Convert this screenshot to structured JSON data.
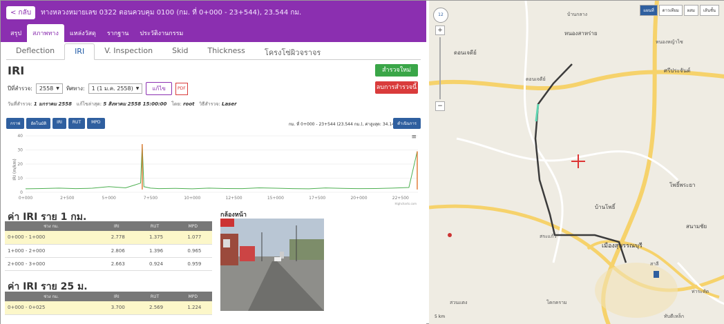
{
  "header": {
    "back_label": "< กลับ",
    "title": "ทางหลวงหมายเลข 0322 ตอนควบคุม 0100 (กม. ที่ 0+000 - 23+544), 23.544 กม."
  },
  "main_tabs": [
    "สรุป",
    "สภาพทาง",
    "แหล่งวัสดุ",
    "รากฐาน",
    "ประวัติงานกรรม"
  ],
  "sub_tabs": [
    "Deflection",
    "IRI",
    "V. Inspection",
    "Skid",
    "Thickness",
    "โครงโซ่ผิวจราจร"
  ],
  "section_heading": "IRI",
  "buttons": {
    "new_survey": "สำรวจใหม่",
    "delete_survey": "ลบการสำรวจนี้",
    "edit": "แก้ไข",
    "pdf": "PDF"
  },
  "filters": {
    "year_label": "ปีที่สำรวจ:",
    "year_value": "2558",
    "dir_label": "ทิศทาง:",
    "dir_value": "1 (1 ม.ค. 2558)"
  },
  "meta": {
    "survey_label": "วันที่สำรวจ:",
    "survey_date": "1 มกราคม 2558",
    "updated_label": "แก้ไขล่าสุด:",
    "updated_date": "5 สิงหาคม 2558 15:00:00",
    "by_label": "โดย:",
    "by_value": "root",
    "method_label": "วิธีสำรวจ:",
    "method_value": "Laser"
  },
  "graph_toolbar": [
    "กราฟ",
    "อัตโนมัติ",
    "IRI",
    "RUT",
    "MPD"
  ],
  "range_info": "กม. ที่ 0+000 - 23+544 (23.544 กม.), ค่าสูงสุด: 34.14",
  "range_button": "ดำเนินการ",
  "chart_data": {
    "type": "line",
    "ylabel": "IRI (m/km)",
    "ylim": [
      0,
      40
    ],
    "yticks": [
      "0",
      "10",
      "20",
      "30",
      "40"
    ],
    "xticks": [
      "0+000",
      "2+500",
      "5+000",
      "7+500",
      "10+000",
      "12+500",
      "15+000",
      "17+500",
      "20+000",
      "22+500"
    ],
    "credit": "Highcharts.com",
    "series": [
      {
        "name": "IRI",
        "x": [
          0,
          1,
          2,
          3,
          4,
          5,
          6,
          6.5,
          6.9,
          7.0,
          7.1,
          7.5,
          8,
          9,
          10,
          11,
          12,
          13,
          14,
          15,
          16,
          17,
          18,
          19,
          20,
          21,
          22,
          23,
          23.5
        ],
        "values": [
          2.5,
          2.7,
          3.0,
          2.6,
          2.9,
          4.0,
          3.2,
          5.0,
          6.5,
          34.1,
          4.0,
          3.0,
          2.6,
          2.8,
          2.5,
          3.0,
          2.7,
          2.6,
          3.2,
          2.9,
          2.6,
          2.5,
          3.1,
          2.8,
          2.6,
          2.7,
          3.0,
          3.4,
          29.0
        ]
      }
    ]
  },
  "table1": {
    "title": "ค่า IRI ราย 1 กม.",
    "headers": [
      "ช่วง กม.",
      "IRI",
      "RUT",
      "MPD"
    ],
    "rows": [
      [
        "0+000 - 1+000",
        "2.778",
        "1.375",
        "1.077"
      ],
      [
        "1+000 - 2+000",
        "2.806",
        "1.396",
        "0.965"
      ],
      [
        "2+000 - 3+000",
        "2.663",
        "0.924",
        "0.959"
      ]
    ]
  },
  "table2": {
    "title": "ค่า IRI ราย 25 ม.",
    "headers": [
      "ช่วง กม.",
      "IRI",
      "RUT",
      "MPD"
    ],
    "rows": [
      [
        "0+000 - 0+025",
        "3.700",
        "2.569",
        "1.224"
      ]
    ]
  },
  "camera_title": "กล้องหน้า",
  "map": {
    "zoom_level": "12",
    "types": [
      "แผนที่",
      "ดาวเทียม",
      "ผสม",
      "เส้นชั้น"
    ],
    "scale": "5 km",
    "labels": [
      "บ้านกลาง",
      "หนองสาหร่าย",
      "ดอนเจดีย์",
      "หนองหญ้าไซ",
      "ศรีประจันต์",
      "ดอนเจดีย์",
      "โพธิ์พระยา",
      "สระแก้ว",
      "บ้านโพธิ์",
      "เมืองสุพรรณบุรี",
      "สนามชัย",
      "ท่าระหัด",
      "สาลี",
      "โคกคราม",
      "ทับตีเหล็ก",
      "สวนแตง"
    ]
  }
}
